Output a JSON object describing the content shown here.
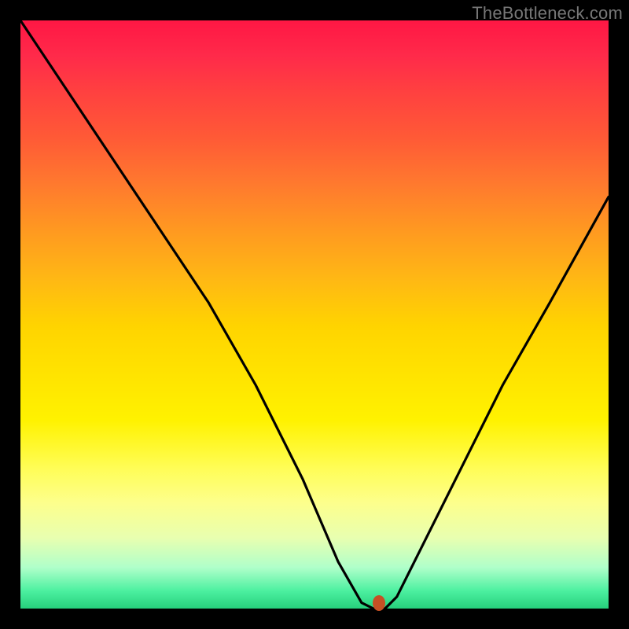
{
  "watermark": "TheBottleneck.com",
  "colors": {
    "frame": "#000000",
    "curve": "#000000",
    "marker": "#c65024",
    "gradient_top": "#ff1744",
    "gradient_bottom": "#26d07c"
  },
  "chart_data": {
    "type": "line",
    "title": "",
    "xlabel": "",
    "ylabel": "",
    "xlim": [
      0,
      100
    ],
    "ylim": [
      0,
      100
    ],
    "grid": false,
    "legend": false,
    "series": [
      {
        "name": "bottleneck-curve",
        "x": [
          0,
          8,
          16,
          24,
          32,
          40,
          48,
          54,
          58,
          60,
          62,
          64,
          68,
          74,
          82,
          90,
          100
        ],
        "values": [
          100,
          88,
          76,
          64,
          52,
          38,
          22,
          8,
          1,
          0,
          0,
          2,
          10,
          22,
          38,
          52,
          70
        ]
      }
    ],
    "annotations": [
      {
        "name": "minimum-marker",
        "x": 61,
        "y": 1
      }
    ],
    "note": "Values estimated from pixel positions; 0,0 is bottom-left. Curve is a V-shaped percentage profile dipping to ~0 near x≈60."
  }
}
